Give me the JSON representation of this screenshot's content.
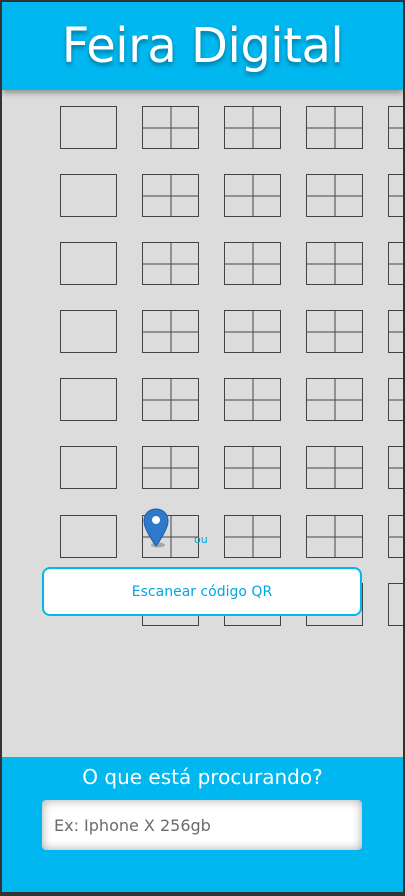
{
  "header": {
    "title": "Feira Digital"
  },
  "map": {
    "separator_text": "ou",
    "pins": [
      "location-pin",
      "location-pin"
    ]
  },
  "actions": {
    "scan_qr_label": "Escanear código QR"
  },
  "search": {
    "heading": "O que está procurando?",
    "placeholder": "Ex: Iphone X 256gb",
    "value": ""
  },
  "colors": {
    "accent": "#00b7ef",
    "background": "#dcdcdc",
    "pin": "#2e79c9"
  }
}
